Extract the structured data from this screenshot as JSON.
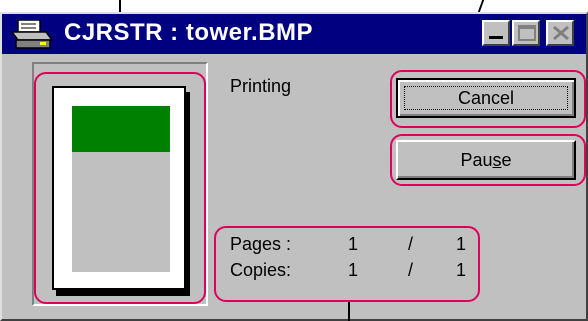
{
  "window": {
    "title": "CJRSTR : tower.BMP",
    "icon": "printer-icon",
    "controls": [
      "minimize-icon",
      "maximize-icon",
      "close-icon"
    ]
  },
  "status": {
    "text": "Printing"
  },
  "buttons": {
    "cancel_label": "Cancel",
    "pause_label_pre": "Pau",
    "pause_label_accel": "s",
    "pause_label_post": "e"
  },
  "progress": {
    "pages_label": "Pages :",
    "pages_current": "1",
    "pages_total": "1",
    "copies_label": "Copies:",
    "copies_current": "1",
    "copies_total": "1",
    "separator": "/"
  },
  "preview": {
    "page_color": "#ffffff",
    "printed_band_color": "#008000"
  },
  "colors": {
    "titlebar": "#000080",
    "window_face": "#c0c0c0",
    "callout": "#e0005a"
  }
}
